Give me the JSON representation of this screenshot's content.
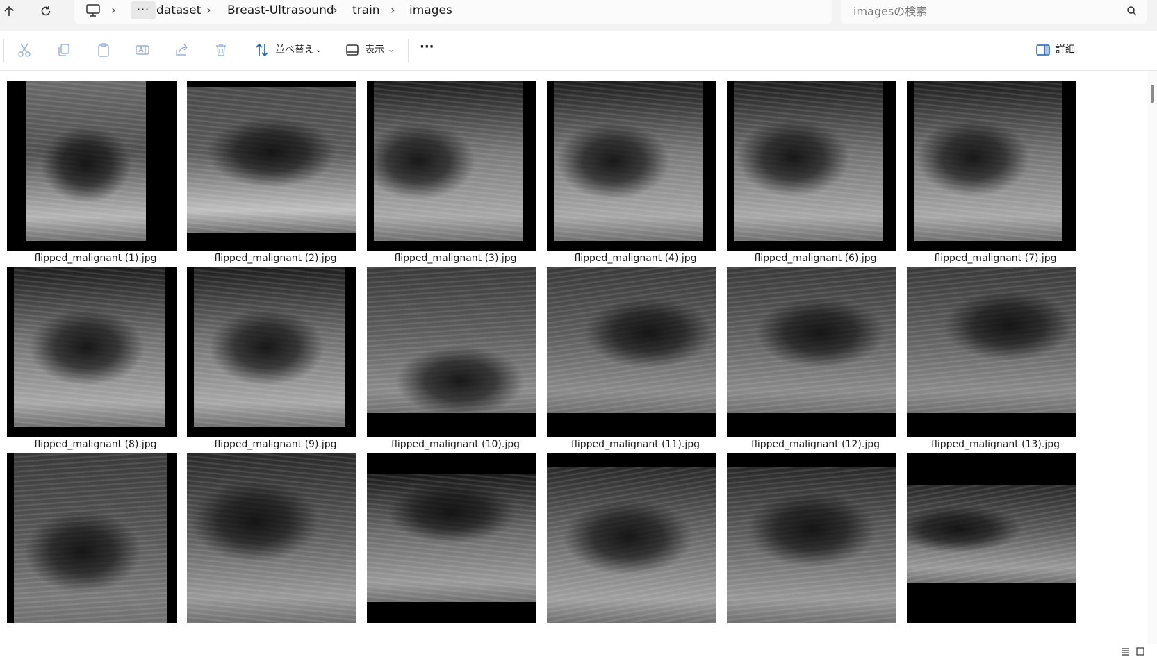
{
  "address": {
    "crumbs": [
      "dataset",
      "Breast-Ultrasound",
      "train",
      "images"
    ],
    "separator": "›",
    "more": "···"
  },
  "search": {
    "placeholder": "imagesの検索"
  },
  "toolbar": {
    "sort_label": "並べ替え",
    "view_label": "表示",
    "more_label": "···",
    "details_label": "詳細"
  },
  "icons": [
    "up-arrow-icon",
    "refresh-icon",
    "this-pc-icon",
    "search-icon",
    "cut-icon",
    "copy-icon",
    "paste-icon",
    "rename-icon",
    "share-icon",
    "delete-icon",
    "sort-icon",
    "view-icon",
    "details-pane-icon",
    "list-view-icon",
    "tile-view-icon"
  ],
  "colors": {
    "chrome": "#f3f3f3",
    "disabled_icon": "#9ab0d6",
    "accent": "#1a5fb4"
  },
  "files": [
    {
      "name": "flipped_malignant (1).jpg"
    },
    {
      "name": "flipped_malignant (2).jpg"
    },
    {
      "name": "flipped_malignant (3).jpg"
    },
    {
      "name": "flipped_malignant (4).jpg"
    },
    {
      "name": "flipped_malignant (6).jpg"
    },
    {
      "name": "flipped_malignant (7).jpg"
    },
    {
      "name": "flipped_malignant (8).jpg"
    },
    {
      "name": "flipped_malignant (9).jpg"
    },
    {
      "name": "flipped_malignant (10).jpg"
    },
    {
      "name": "flipped_malignant (11).jpg"
    },
    {
      "name": "flipped_malignant (12).jpg"
    },
    {
      "name": "flipped_malignant (13).jpg"
    },
    {
      "name": ""
    },
    {
      "name": ""
    },
    {
      "name": ""
    },
    {
      "name": ""
    },
    {
      "name": ""
    },
    {
      "name": ""
    }
  ]
}
